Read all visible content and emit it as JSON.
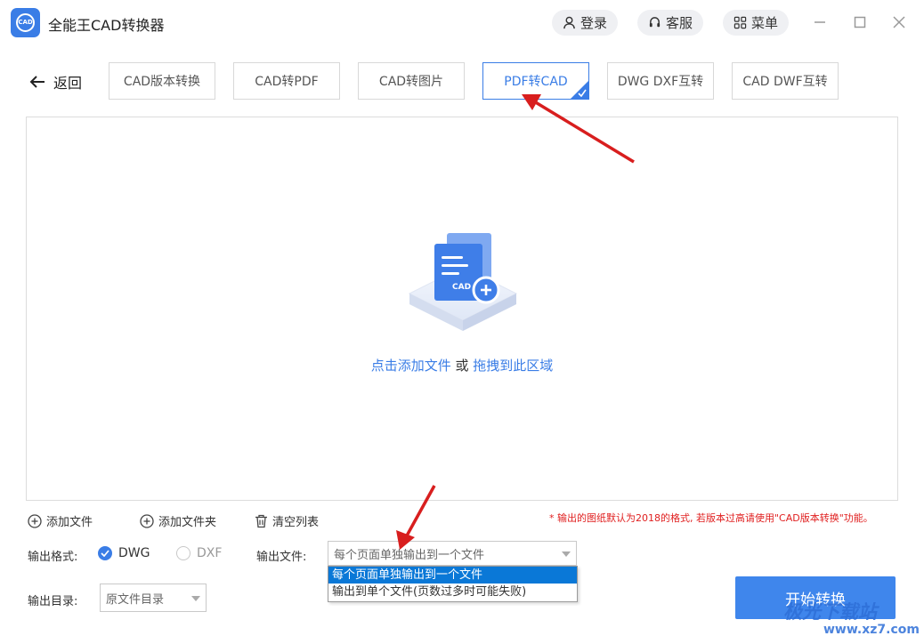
{
  "app": {
    "title": "全能王CAD转换器",
    "logo_text": "CAD"
  },
  "header": {
    "login_label": "登录",
    "service_label": "客服",
    "menu_label": "菜单"
  },
  "toolbar": {
    "back_label": "返回",
    "tabs": [
      {
        "label": "CAD版本转换",
        "active": false
      },
      {
        "label": "CAD转PDF",
        "active": false
      },
      {
        "label": "CAD转图片",
        "active": false
      },
      {
        "label": "PDF转CAD",
        "active": true
      },
      {
        "label": "DWG DXF互转",
        "active": false
      },
      {
        "label": "CAD DWF互转",
        "active": false
      }
    ]
  },
  "dropzone": {
    "badge": "CAD",
    "link_add": "点击添加文件",
    "connector": " 或 ",
    "link_drag": "拖拽到此区域"
  },
  "file_actions": {
    "add_file": "添加文件",
    "add_folder": "添加文件夹",
    "clear_list": "清空列表"
  },
  "note": "* 输出的图纸默认为2018的格式, 若版本过高请使用\"CAD版本转换\"功能。",
  "options": {
    "format_label": "输出格式:",
    "format_dwg": "DWG",
    "format_dxf": "DXF",
    "format_selected": "DWG",
    "output_file_label": "输出文件:",
    "output_file_value": "每个页面单独输出到一个文件",
    "output_file_options": [
      "每个页面单独输出到一个文件",
      "输出到单个文件(页数过多时可能失败)"
    ],
    "output_dir_label": "输出目录:",
    "output_dir_value": "原文件目录"
  },
  "start_button": "开始转换",
  "watermark": {
    "text": "极光下载站",
    "url": "www.xz7.com"
  },
  "colors": {
    "accent": "#3a7de6",
    "note": "#e02020",
    "selection": "#0a78d7",
    "annotation_arrow": "#d81e1e"
  }
}
